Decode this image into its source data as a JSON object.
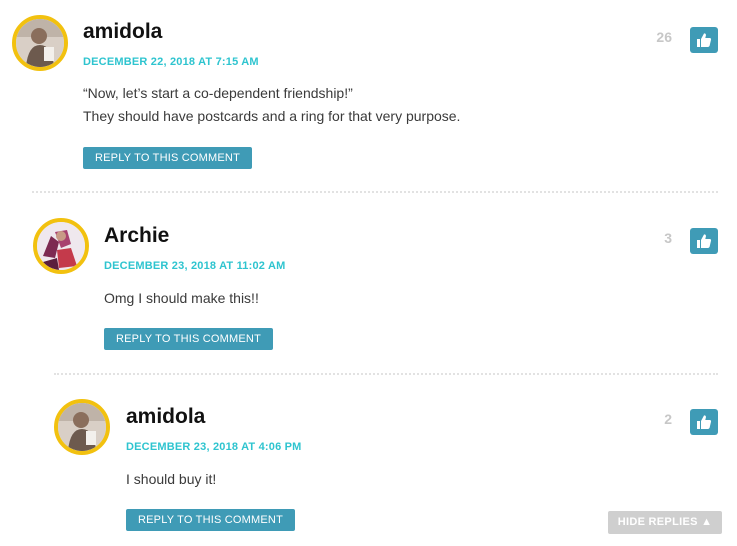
{
  "comments": [
    {
      "author": "amidola",
      "date": "DECEMBER 22, 2018 AT 7:15 AM",
      "lines": [
        "“Now, let’s start a co-dependent friendship!”",
        "They should have postcards and a ring for that very purpose."
      ],
      "reply_label": "REPLY TO THIS COMMENT",
      "likes": "26"
    },
    {
      "author": "Archie",
      "date": "DECEMBER 23, 2018 AT 11:02 AM",
      "lines": [
        "Omg I should make this!!"
      ],
      "reply_label": "REPLY TO THIS COMMENT",
      "likes": "3"
    },
    {
      "author": "amidola",
      "date": "DECEMBER 23, 2018 AT 4:06 PM",
      "lines": [
        "I should buy it!"
      ],
      "reply_label": "REPLY TO THIS COMMENT",
      "likes": "2"
    }
  ],
  "hide_replies_label": "HIDE REPLIES ▲",
  "colors": {
    "accent": "#3f9bb6",
    "date": "#2ec4cf",
    "avatar_ring": "#f2c10f"
  },
  "icons": {
    "like": "thumbs-up-icon",
    "hide_replies_arrow": "caret-up-icon"
  }
}
